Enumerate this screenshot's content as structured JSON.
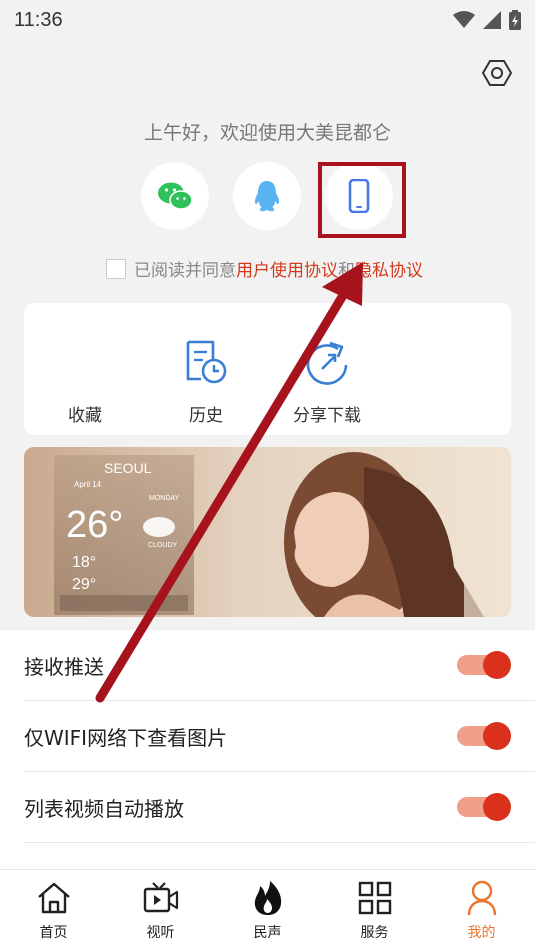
{
  "status_bar": {
    "time": "11:36"
  },
  "greeting": "上午好，欢迎使用大美昆都仑",
  "login": {
    "options": [
      "wechat-login",
      "qq-login",
      "phone-login"
    ]
  },
  "agreement": {
    "prefix": "已阅读并同意",
    "user_agreement": "用户使用协议",
    "and": "和",
    "privacy": "隐私协议"
  },
  "quick_actions": [
    {
      "label": "收藏",
      "icon": "favorites-icon"
    },
    {
      "label": "历史",
      "icon": "history-icon"
    },
    {
      "label": "分享下载",
      "icon": "share-icon"
    }
  ],
  "banner": {
    "city": "SEOUL",
    "date": "April 14",
    "day": "MONDAY",
    "temp": "26°",
    "condition": "CLOUDY",
    "low": "18°",
    "high": "29°"
  },
  "settings": [
    {
      "label": "接收推送",
      "on": true
    },
    {
      "label": "仅WIFI网络下查看图片",
      "on": true
    },
    {
      "label": "列表视频自动播放",
      "on": true
    }
  ],
  "tabs": [
    {
      "label": "首页",
      "icon": "home-icon",
      "active": false
    },
    {
      "label": "视听",
      "icon": "video-icon",
      "active": false
    },
    {
      "label": "民声",
      "icon": "flame-icon",
      "active": false
    },
    {
      "label": "服务",
      "icon": "grid-icon",
      "active": false
    },
    {
      "label": "我的",
      "icon": "profile-icon",
      "active": true
    }
  ],
  "colors": {
    "accent": "#e8762e",
    "link": "#d33a1c",
    "toggle_on": "#d9311c",
    "annotation": "#a6131c"
  }
}
